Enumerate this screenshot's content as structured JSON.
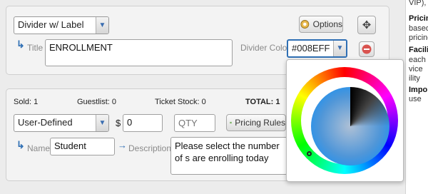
{
  "side": {
    "lines": [
      {
        "text": "VIP), e",
        "bold": false
      },
      {
        "text": "Pricin",
        "bold": true
      },
      {
        "text": "based",
        "bold": false
      },
      {
        "text": "pricing",
        "bold": false
      },
      {
        "text": "Faciliti",
        "bold": true
      },
      {
        "text": "each t",
        "bold": false
      },
      {
        "text": "vice",
        "bold": false
      },
      {
        "text": "ility",
        "bold": false
      },
      {
        "text": "Impo",
        "bold": true
      },
      {
        "text": "use",
        "bold": false
      }
    ]
  },
  "divider": {
    "type_value": "Divider w/ Label",
    "options_label": "Options",
    "title_label": "Title",
    "title_value": "ENROLLMENT",
    "color_label": "Divider Color",
    "color_value": "#008EFF",
    "accent": "#008EFF"
  },
  "ticket": {
    "sold": "Sold: 1",
    "guestlist": "Guestlist: 0",
    "stock": "Ticket Stock: 0",
    "total": "TOTAL: 1",
    "type_value": "User-Defined",
    "currency": "$",
    "price": "0",
    "qty_placeholder": "QTY",
    "pricing_rules_label": "Pricing Rules",
    "name_label": "Name",
    "name_value": "Student",
    "description_label": "Description",
    "description_value": "Please select the number of s are enrolling today"
  },
  "colors": {
    "panel_bg": "#f3f3f3",
    "link_blue": "#2f6fb4",
    "danger": "#d9534f"
  }
}
